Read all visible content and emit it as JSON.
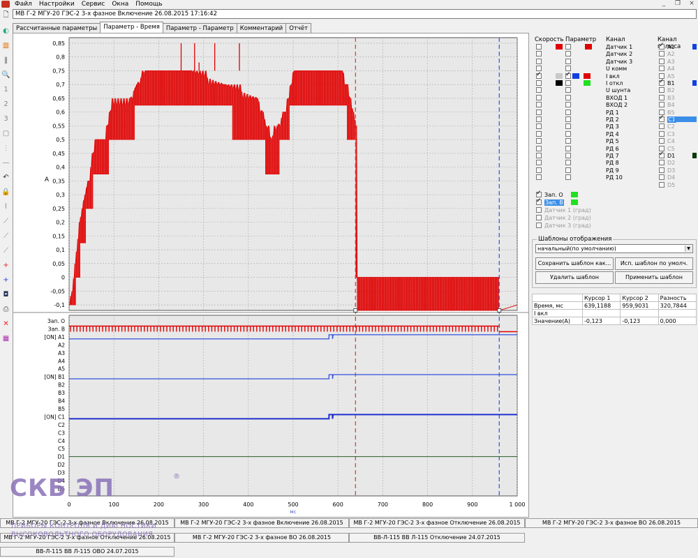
{
  "menu": {
    "items": [
      "Файл",
      "Настройки",
      "Сервис",
      "Окна",
      "Помощь"
    ]
  },
  "window_title": "МВ Г-2 МГУ-20 ГЭС-2 3-х фазное Включение 26.08.2015 17:16:42",
  "tabs": [
    "Рассчитанные параметры",
    "Параметр - Время",
    "Параметр - Параметр",
    "Комментарий",
    "Отчёт"
  ],
  "active_tab": 1,
  "chart_data": [
    {
      "type": "line",
      "title": "",
      "ylabel": "A",
      "xlabel": "",
      "xlim": [
        0,
        1000
      ],
      "ylim": [
        -0.12,
        0.87
      ],
      "yticks": [
        "0,85",
        "0,8",
        "0,75",
        "0,7",
        "0,65",
        "0,6",
        "0,55",
        "0,5",
        "0,45",
        "0,4",
        "0,35",
        "0,3",
        "0,25",
        "0,2",
        "0,15",
        "0,1",
        "0,05",
        "0",
        "-0,05",
        "-0,1"
      ],
      "ytick_values": [
        0.85,
        0.8,
        0.75,
        0.7,
        0.65,
        0.6,
        0.55,
        0.5,
        0.45,
        0.4,
        0.35,
        0.3,
        0.25,
        0.2,
        0.15,
        0.1,
        0.05,
        0,
        -0.05,
        -0.1
      ],
      "series": [
        {
          "color": "#e00000",
          "envelope": [
            [
              0,
              -0.1
            ],
            [
              10,
              0.0
            ],
            [
              18,
              0.125
            ],
            [
              28,
              0.25
            ],
            [
              45,
              0.375
            ],
            [
              60,
              0.5
            ],
            [
              80,
              0.5
            ],
            [
              95,
              0.625
            ],
            [
              130,
              0.625
            ],
            [
              150,
              0.7
            ],
            [
              170,
              0.75
            ],
            [
              270,
              0.75
            ],
            [
              420,
              0.65
            ],
            [
              450,
              0.5
            ],
            [
              480,
              0.6
            ],
            [
              500,
              0.75
            ],
            [
              610,
              0.75
            ],
            [
              640,
              0.55
            ],
            [
              641,
              -0.12
            ],
            [
              960,
              -0.12
            ],
            [
              1000,
              -0.1
            ]
          ],
          "spikes": [
            [
              250,
              0.85
            ],
            [
              280,
              0.85
            ],
            [
              290,
              0.78
            ],
            [
              325,
              0.85
            ],
            [
              380,
              0.85
            ]
          ]
        }
      ],
      "cursors": [
        {
          "x": 639.1188,
          "color": "#e83030"
        },
        {
          "x": 959.9031,
          "color": "#3050e0"
        }
      ]
    },
    {
      "type": "line",
      "title": "",
      "xlabel": "мс",
      "xlim": [
        0,
        1000
      ],
      "xticks": [
        "0",
        "100",
        "200",
        "300",
        "400",
        "500",
        "600",
        "700",
        "800",
        "900",
        "1 000"
      ],
      "xtick_values": [
        0,
        100,
        200,
        300,
        400,
        500,
        600,
        700,
        800,
        900,
        1000
      ],
      "channels": [
        "Зап. О",
        "Зап. В",
        "[ON] A1",
        "A2",
        "A3",
        "A4",
        "A5",
        "[ON] B1",
        "B2",
        "B3",
        "B4",
        "B5",
        "[ON] C1",
        "C2",
        "C3",
        "C4",
        "C5",
        "D1",
        "D2",
        "D3",
        "D4",
        "D5"
      ],
      "traces": [
        {
          "channel": "Зап. В",
          "color": "#e00000",
          "pulsed_until": 960
        },
        {
          "channel": "[ON] A1",
          "color": "#3050e0",
          "step_at": 580
        },
        {
          "channel": "[ON] B1",
          "color": "#3050e0",
          "step_at": 580
        },
        {
          "channel": "[ON] C1",
          "color": "#2030d0",
          "step_at": 580
        },
        {
          "channel": "D1",
          "color": "#2a5a2a",
          "step_at": null
        }
      ]
    }
  ],
  "panel": {
    "col_speed": "Скорость",
    "col_param": "Параметр",
    "col_channel": "Канал",
    "col_channel_pole": "Канал полюса",
    "channels": [
      "Датчик 1",
      "Датчик 2",
      "Датчик 3",
      "U комм",
      "I вкл",
      "I откл",
      "U шунта",
      "ВХОД 1",
      "ВХОД 2",
      "РД 1",
      "РД 2",
      "РД 3",
      "РД 4",
      "РД 5",
      "РД 6",
      "РД 7",
      "РД 8",
      "РД 9",
      "РД 10"
    ],
    "poles": [
      "A1",
      "A2",
      "A3",
      "A4",
      "A5",
      "B1",
      "B2",
      "B3",
      "B4",
      "B5",
      "C1",
      "C2",
      "C3",
      "C4",
      "C5",
      "D1",
      "D2",
      "D3",
      "D4",
      "D5"
    ],
    "zap": [
      "Зап. О",
      "Зап. В",
      "Датчик 1 (град)",
      "Датчик 2 (град)",
      "Датчик 3 (град)"
    ],
    "templates_label": "Шаблоны отображения",
    "template_value": "начальный(по умолчанию)",
    "btn_save": "Сохранить шаблон как...",
    "btn_default": "Исп. шаблон по умолч.",
    "btn_delete": "Удалить шаблон",
    "btn_apply": "Применить шаблон",
    "colors": {
      "red": "#e00000",
      "green": "#20e020",
      "blue": "#1040e0",
      "dark": "#000000",
      "gray": "#c8c8c8",
      "darkgreen": "#0a3a0a",
      "lightblue": "#3a8ee8"
    }
  },
  "cursor_table": {
    "headers": [
      "",
      "Курсор 1",
      "Курсор 2",
      "Разность"
    ],
    "rows": [
      [
        "Время, мс",
        "639,1188",
        "959,9031",
        "320,7844"
      ],
      [
        "I вкл",
        "",
        "",
        ""
      ],
      [
        "Значение(А)",
        "-0,123",
        "-0,123",
        "0,000"
      ]
    ]
  },
  "bottom_tabs": [
    "МВ Г-2 МГУ-20 ГЭС-2 3-х фазное Включение 26.08.2015",
    "МВ Г-2 МГУ-20 ГЭС-2 3-х фазное Отключение 26.08.2015",
    "МВ Г-2 МГУ-20 ГЭС-2 3-х фазное ВО 26.08.2015",
    "МВ Г-2 МГУ-20 ГЭС-2 3-х фазное ВО 26.08.2015",
    "ВВ-Л-115  ВВ Л-115 Отключение 24.07.2015",
    "ВВ-Л-115  ВВ Л-115 ОВО 24.07.2015"
  ],
  "logo": {
    "brand": "СКБ ЭП",
    "reg": "®",
    "subtitle": "ПРИБОРЫ КОНТРОЛЯ И ДИАГНОСТИКИ ВЫСОКОВОЛЬТНОГО ОБОРУДОВАНИЯ"
  },
  "toolbar_icons": [
    "new-file-icon",
    "open-icon",
    "chart-icon",
    "bars-icon",
    "zoom-icon",
    "cursor1-icon",
    "cursor2-icon",
    "cursor3-icon",
    "frame-icon",
    "pause-icon",
    "line-icon",
    "undo-icon",
    "lock-icon",
    "scale-icon",
    "graph1-icon",
    "graph2-icon",
    "graph3-icon",
    "plus-red-icon",
    "plus-blue-icon",
    "point-icon",
    "print-icon",
    "delete-icon",
    "export-icon"
  ]
}
